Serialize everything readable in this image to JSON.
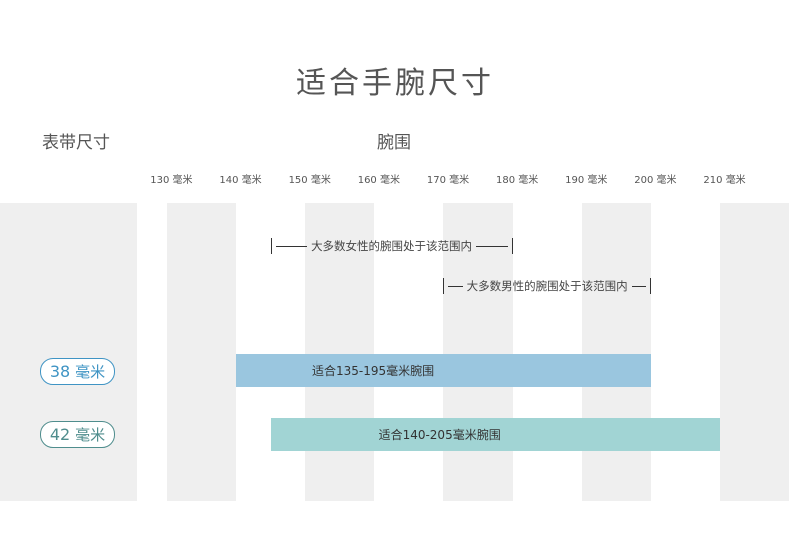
{
  "title": "适合手腕尺寸",
  "band_header": "表带尺寸",
  "wrist_header": "腕围",
  "chart_data": {
    "type": "bar",
    "x": {
      "min": 120,
      "max": 220,
      "ticks": [
        130,
        140,
        150,
        160,
        170,
        180,
        190,
        200,
        210
      ],
      "tick_labels": [
        "130 毫米",
        "140 毫米",
        "150 毫米",
        "160 毫米",
        "170 毫米",
        "180 毫米",
        "190 毫米",
        "200 毫米",
        "210 毫米"
      ]
    },
    "annotations": [
      {
        "label": "大多数女性的腕围处于该范围内",
        "start": 140,
        "end": 175
      },
      {
        "label": "大多数男性的腕围处于该范围内",
        "start": 165,
        "end": 195
      }
    ],
    "bars": [
      {
        "band": "38 毫米",
        "band_num": "38",
        "band_unit": "毫米",
        "label": "适合135-195毫米腕围",
        "start": 135,
        "end": 195,
        "color": "#9ac6df",
        "pill_color": "#3f94c4"
      },
      {
        "band": "42 毫米",
        "band_num": "42",
        "band_unit": "毫米",
        "label": "适合140-205毫米腕围",
        "start": 140,
        "end": 205,
        "color": "#a1d4d4",
        "pill_color": "#4f8d8d"
      }
    ]
  }
}
